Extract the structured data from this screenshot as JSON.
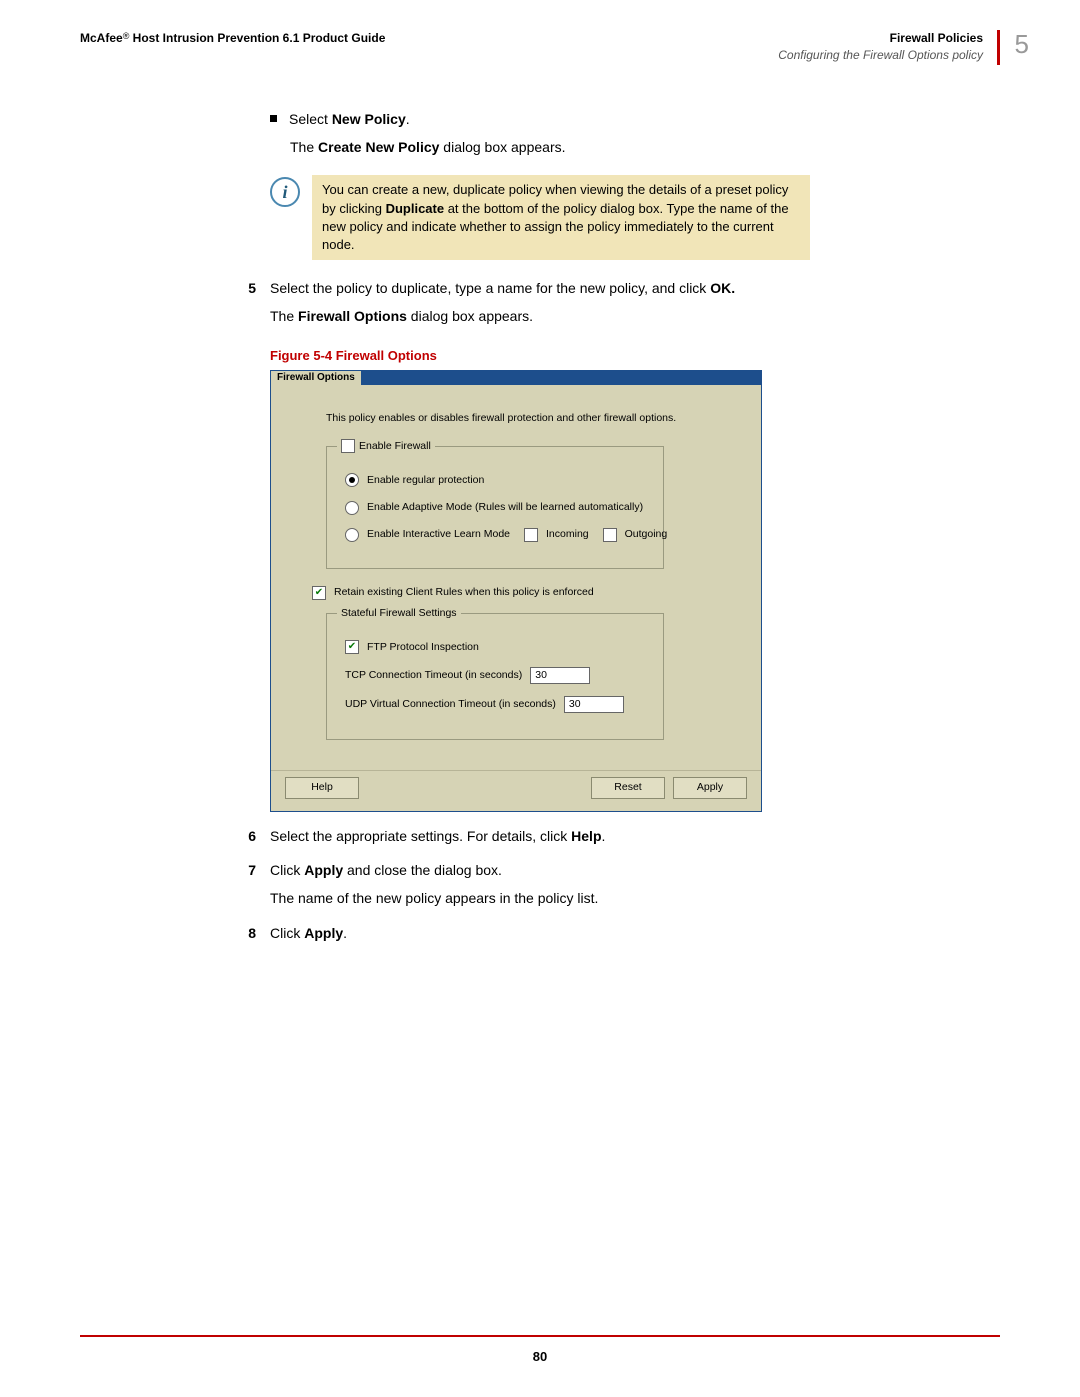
{
  "header": {
    "brand": "McAfee",
    "reg": "®",
    "doc_title": "Host Intrusion Prevention 6.1 Product Guide",
    "section_title": "Firewall Policies",
    "section_subtitle": "Configuring the Firewall Options policy",
    "chapter_number": "5"
  },
  "bullet": {
    "prefix": "Select ",
    "bold": "New Policy",
    "suffix": ".",
    "follow_pre": "The ",
    "follow_bold": "Create New Policy",
    "follow_post": " dialog box appears."
  },
  "note": {
    "line1_pre": "You can create a new, duplicate policy when viewing the details of a preset policy by clicking ",
    "line1_bold": "Duplicate",
    "line1_post": " at the bottom of the policy dialog box. Type the name of the new policy and indicate whether to assign the policy immediately to the current node."
  },
  "step5": {
    "num": "5",
    "text_pre": "Select the policy to duplicate, type a name for the new policy, and click ",
    "text_bold": "OK.",
    "follow_pre": "The ",
    "follow_bold": "Firewall Options",
    "follow_post": " dialog box appears."
  },
  "figure_caption": "Figure 5-4  Firewall Options",
  "dialog": {
    "tab": "Firewall Options",
    "description": "This policy enables or disables firewall protection and other firewall options.",
    "group1": {
      "title": "Enable Firewall",
      "title_checked": false,
      "opt1": "Enable regular protection",
      "opt2": "Enable Adaptive Mode (Rules will be learned automatically)",
      "opt3": "Enable Interactive Learn Mode",
      "opt3_cb1": "Incoming",
      "opt3_cb2": "Outgoing"
    },
    "retain": "Retain existing Client Rules when this policy is enforced",
    "group2": {
      "title": "Stateful Firewall Settings",
      "ftp": "FTP Protocol Inspection",
      "tcp_label": "TCP Connection Timeout (in seconds)",
      "tcp_value": "30",
      "udp_label": "UDP Virtual Connection Timeout (in seconds)",
      "udp_value": "30"
    },
    "buttons": {
      "help": "Help",
      "reset": "Reset",
      "apply": "Apply"
    }
  },
  "step6": {
    "num": "6",
    "pre": "Select the appropriate settings. For details, click ",
    "bold": "Help",
    "post": "."
  },
  "step7": {
    "num": "7",
    "pre": "Click ",
    "bold": "Apply",
    "post": " and close the dialog box.",
    "follow": "The name of the new policy appears in the policy list."
  },
  "step8": {
    "num": "8",
    "pre": "Click ",
    "bold": "Apply",
    "post": "."
  },
  "page_number": "80"
}
